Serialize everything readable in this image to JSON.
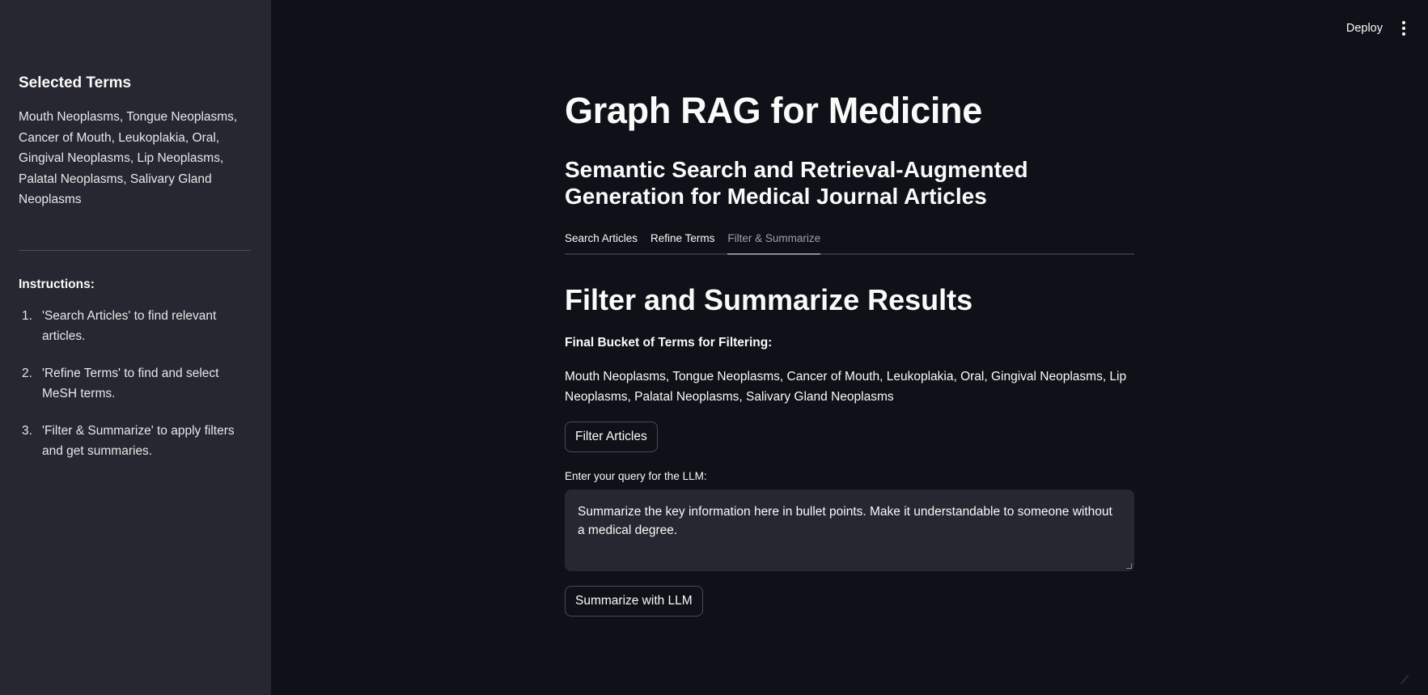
{
  "sidebar": {
    "title": "Selected Terms",
    "terms": "Mouth Neoplasms, Tongue Neoplasms, Cancer of Mouth, Leukoplakia, Oral, Gingival Neoplasms, Lip Neoplasms, Palatal Neoplasms, Salivary Gland Neoplasms",
    "instructions_title": "Instructions:",
    "instructions": [
      {
        "num": "1.",
        "text": "'Search Articles' to find relevant articles."
      },
      {
        "num": "2.",
        "text": "'Refine Terms' to find and select MeSH terms."
      },
      {
        "num": "3.",
        "text": "'Filter & Summarize' to apply filters and get summaries."
      }
    ]
  },
  "header": {
    "deploy_label": "Deploy",
    "menu_icon": "kebab-menu-icon"
  },
  "main": {
    "title": "Graph RAG for Medicine",
    "subtitle": "Semantic Search and Retrieval-Augmented Generation for Medical Journal Articles",
    "tabs": [
      {
        "label": "Search Articles",
        "active": false
      },
      {
        "label": "Refine Terms",
        "active": false
      },
      {
        "label": "Filter & Summarize",
        "active": true
      }
    ],
    "section_title": "Filter and Summarize Results",
    "bucket_label": "Final Bucket of Terms for Filtering:",
    "bucket_terms": "Mouth Neoplasms, Tongue Neoplasms, Cancer of Mouth, Leukoplakia, Oral, Gingival Neoplasms, Lip Neoplasms, Palatal Neoplasms, Salivary Gland Neoplasms",
    "filter_button": "Filter Articles",
    "query_label": "Enter your query for the LLM:",
    "query_value": "Summarize the key information here in bullet points. Make it understandable to someone without a medical degree.",
    "summarize_button": "Summarize with LLM"
  },
  "colors": {
    "background": "#0e1117",
    "sidebar": "#262730",
    "text": "#fafafa",
    "input_bg": "#262730"
  }
}
